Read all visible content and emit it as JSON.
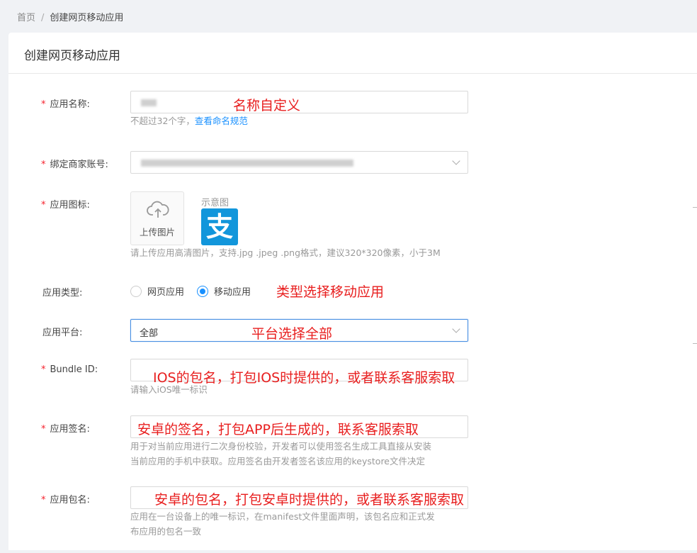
{
  "breadcrumb": {
    "home": "首页",
    "separator": "/",
    "current": "创建网页移动应用"
  },
  "page_title": "创建网页移动应用",
  "form": {
    "name": {
      "label": "应用名称:",
      "help_prefix": "不超过32个字，",
      "help_link": "查看命名规范",
      "annotation": "名称自定义"
    },
    "merchant": {
      "label": "绑定商家账号:"
    },
    "icon": {
      "label": "应用图标:",
      "upload_text": "上传图片",
      "demo_label": "示意图",
      "demo_icon_glyph": "支",
      "help": "请上传应用高清图片，支持.jpg .jpeg .png格式，建议320*320像素，小于3M"
    },
    "type": {
      "label": "应用类型:",
      "options": [
        {
          "label": "网页应用",
          "checked": false
        },
        {
          "label": "移动应用",
          "checked": true
        }
      ],
      "annotation": "类型选择移动应用"
    },
    "platform": {
      "label": "应用平台:",
      "value": "全部",
      "annotation": "平台选择全部"
    },
    "bundle": {
      "label": "Bundle ID:",
      "help": "请输入iOS唯一标识",
      "annotation": "IOS的包名，打包IOS时提供的，或者联系客服索取"
    },
    "signature": {
      "label": "应用签名:",
      "help_line1": "用于对当前应用进行二次身份校验，开发者可以使用签名生成工具直接从安装",
      "help_line2": "当前应用的手机中获取。应用签名由开发者签名该应用的keystore文件决定",
      "annotation": "安卓的签名，打包APP后生成的，联系客服索取"
    },
    "package": {
      "label": "应用包名:",
      "help_line1": "应用在一台设备上的唯一标识，在manifest文件里面声明，该包名应和正式发",
      "help_line2": "布应用的包名一致",
      "annotation": "安卓的包名，打包安卓时提供的，或者联系客服索取"
    },
    "required_mark": "*"
  },
  "colors": {
    "annotation_red": "#e81e1e",
    "link_blue": "#1890ff",
    "alipay_blue": "#1296db",
    "focus_border": "#4a90e2"
  }
}
